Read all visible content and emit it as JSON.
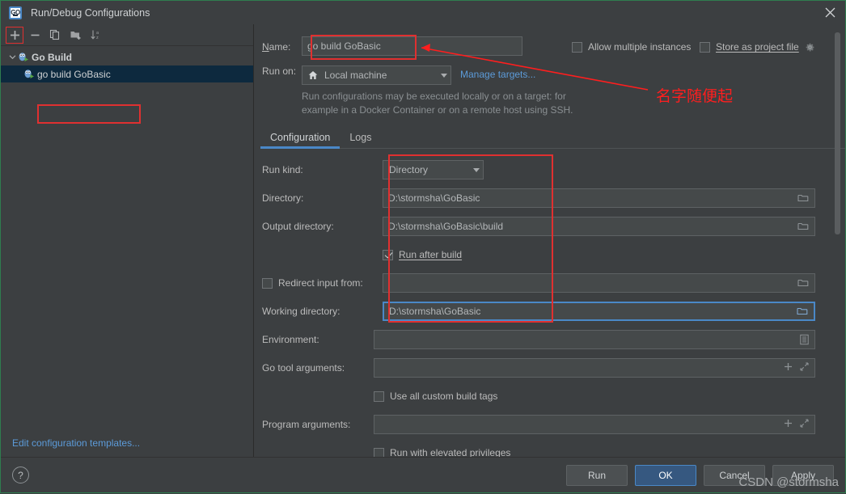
{
  "window": {
    "title": "Run/Debug Configurations",
    "app_icon": "go-logo-icon",
    "close_label": "×"
  },
  "left_panel": {
    "toolbar": [
      {
        "name": "add-button",
        "glyph": "+"
      },
      {
        "name": "remove-button",
        "glyph": "−"
      },
      {
        "name": "copy-button",
        "glyph": "copy-icon"
      },
      {
        "name": "new-folder-button",
        "glyph": "folder-add-icon"
      },
      {
        "name": "sort-button",
        "glyph": "sort-alphabetically-icon"
      }
    ],
    "tree": {
      "group_label": "Go Build",
      "child_label": "go build GoBasic"
    },
    "edit_templates_link": "Edit configuration templates..."
  },
  "right_panel": {
    "name_label": "Name:",
    "name_label_underline": "N",
    "name_value": "go build GoBasic",
    "allow_multiple_instances": {
      "label": "Allow multiple instances",
      "checked": false
    },
    "store_as_project_file": {
      "label": "Store as project file",
      "checked": false
    },
    "run_on_label": "Run on:",
    "run_on_value": "Local machine",
    "manage_targets_link": "Manage targets...",
    "hint_line1": "Run configurations may be executed locally or on a target: for",
    "hint_line2": "example in a Docker Container or on a remote host using SSH.",
    "tabs": [
      {
        "label": "Configuration",
        "active": true
      },
      {
        "label": "Logs",
        "active": false
      }
    ],
    "fields": {
      "run_kind": {
        "label": "Run kind:",
        "value": "Directory"
      },
      "directory": {
        "label": "Directory:",
        "value": "D:\\stormsha\\GoBasic"
      },
      "output_directory": {
        "label": "Output directory:",
        "value": "D:\\stormsha\\GoBasic\\build"
      },
      "run_after_build": {
        "label": "Run after build",
        "checked": true
      },
      "redirect_input_from": {
        "label": "Redirect input from:",
        "checked": false,
        "value": ""
      },
      "working_directory": {
        "label": "Working directory:",
        "value": "D:\\stormsha\\GoBasic",
        "focused": true
      },
      "environment": {
        "label": "Environment:",
        "value": ""
      },
      "go_tool_arguments": {
        "label": "Go tool arguments:",
        "value": ""
      },
      "use_all_custom_build_tags": {
        "label": "Use all custom build tags",
        "checked": false
      },
      "program_arguments": {
        "label": "Program arguments:",
        "value": ""
      },
      "run_with_elevated_privileges": {
        "label": "Run with elevated privileges",
        "checked": false
      }
    }
  },
  "annotations": {
    "callout_text": "名字随便起",
    "color": "#ff1e1e"
  },
  "footer": {
    "help_label": "?",
    "buttons": [
      {
        "name": "run-button",
        "label": "Run",
        "primary": false
      },
      {
        "name": "ok-button",
        "label": "OK",
        "primary": true
      },
      {
        "name": "cancel-button",
        "label": "Cancel",
        "primary": false
      },
      {
        "name": "apply-button",
        "label": "Apply",
        "primary": false
      }
    ]
  },
  "watermark": "CSDN @stormsha",
  "colors": {
    "background": "#3c3f41",
    "accent": "#4a88c7",
    "link": "#5c9bd9",
    "selection": "#0d293e",
    "annotation_red": "#e03030",
    "primary_button": "#365880"
  }
}
